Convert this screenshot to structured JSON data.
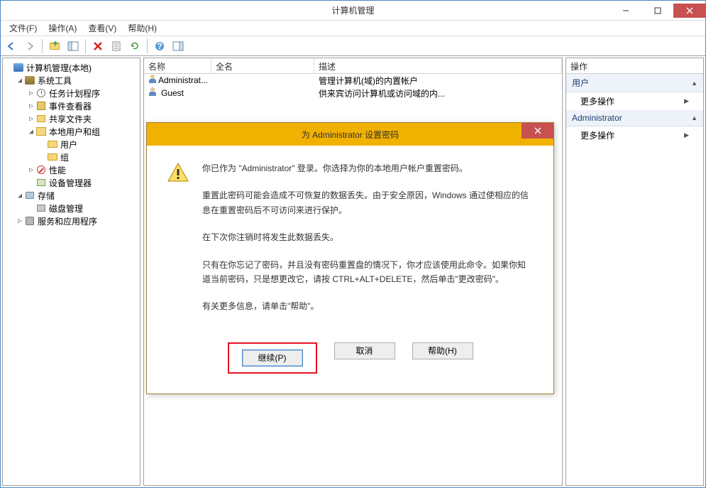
{
  "window": {
    "title": "计算机管理"
  },
  "menu": {
    "file": "文件(F)",
    "action": "操作(A)",
    "view": "查看(V)",
    "help": "帮助(H)"
  },
  "tree": {
    "root": "计算机管理(本地)",
    "system_tools": "系统工具",
    "task_scheduler": "任务计划程序",
    "event_viewer": "事件查看器",
    "shared_folders": "共享文件夹",
    "local_users": "本地用户和组",
    "users": "用户",
    "groups": "组",
    "performance": "性能",
    "device_manager": "设备管理器",
    "storage": "存储",
    "disk_management": "磁盘管理",
    "services_apps": "服务和应用程序"
  },
  "list": {
    "headers": {
      "name": "名称",
      "fullname": "全名",
      "description": "描述"
    },
    "rows": [
      {
        "name": "Administrat...",
        "fullname": "",
        "description": "管理计算机(域)的内置帐户"
      },
      {
        "name": "Guest",
        "fullname": "",
        "description": "供来宾访问计算机或访问域的内..."
      }
    ]
  },
  "actions": {
    "header": "操作",
    "section_users": "用户",
    "more": "更多操作",
    "section_admin": "Administrator"
  },
  "dialog": {
    "title": "为 Administrator 设置密码",
    "p1": "你已作为 \"Administrator\" 登录。你选择为你的本地用户帐户重置密码。",
    "p2": "重置此密码可能会造成不可恢复的数据丢失。由于安全原因，Windows 通过使相应的信息在重置密码后不可访问来进行保护。",
    "p3": "在下次你注销时将发生此数据丢失。",
    "p4": "只有在你忘记了密码，并且没有密码重置盘的情况下，你才应该使用此命令。如果你知道当前密码，只是想更改它，请按 CTRL+ALT+DELETE，然后单击\"更改密码\"。",
    "p5": "有关更多信息，请单击\"帮助\"。",
    "btn_continue": "继续(P)",
    "btn_cancel": "取消",
    "btn_help": "帮助(H)"
  }
}
